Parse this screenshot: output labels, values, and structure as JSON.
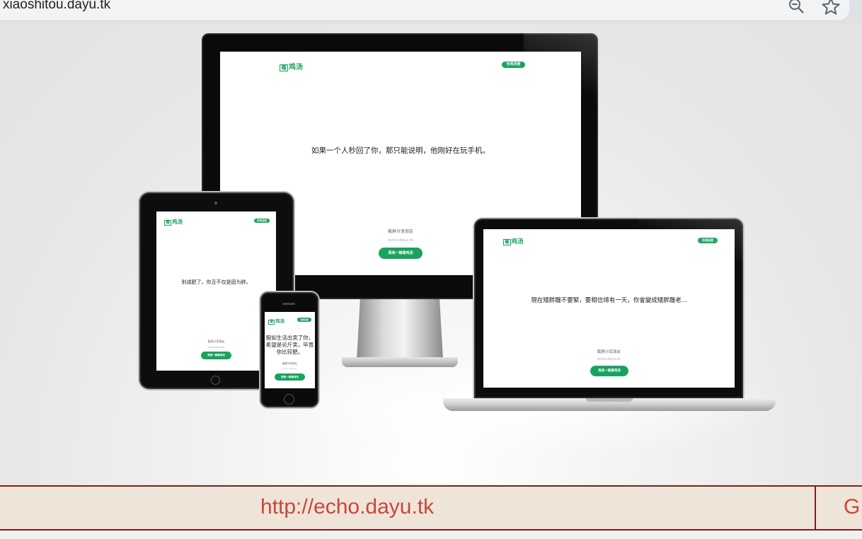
{
  "browser": {
    "url": "xiaoshitou.dayu.tk",
    "zoom_icon": "zoom-out-icon",
    "star_icon": "star-icon"
  },
  "brand": {
    "logo_mark": "毒",
    "logo_text": "鸡汤",
    "accent": "#1aa260"
  },
  "monitor": {
    "button": "无鸡汤官",
    "quote": "如果一个人秒回了你，那只能说明，他刚好在玩手机。",
    "share": "截屏分享朋友",
    "domain": "echo.dayu.tk",
    "cta": "再来一碗毒鸡汤"
  },
  "tablet": {
    "button": "无鸡汤官",
    "quote": "别减肥了，你丑不仅是因为胖。",
    "share": "截屏分享朋友",
    "domain": "echo.dayu.tk",
    "cta": "再来一碗毒鸡汤"
  },
  "phone": {
    "button": "无鸡汤官",
    "quote_lines": [
      "假如生活出卖了你，",
      "希望是论斤卖，毕竟",
      "你比较肥。"
    ],
    "share": "截屏分享朋友",
    "domain": "echo.dayu.tk",
    "cta": "再来一碗毒鸡汤"
  },
  "laptop": {
    "button": "无鸡汤官",
    "quote": "現在矮胖醜不要緊，要相信總有一天，你會變成矮胖醜老...",
    "share": "截屏分享朋友",
    "domain": "echo.dayu.tk",
    "cta": "再来一碗毒鸡汤"
  },
  "linkbar": {
    "link": "http://echo.dayu.tk",
    "next_cell": "G",
    "text_color": "#c8473d",
    "border_color": "#7b1e1e"
  }
}
